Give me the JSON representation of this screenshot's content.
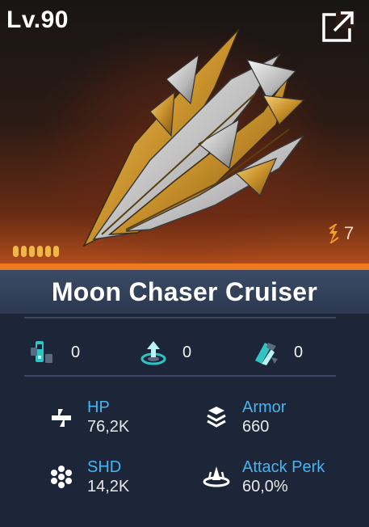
{
  "card": {
    "level": "Lv.90",
    "name": "Moon Chaser Cruiser",
    "energy_value": "7",
    "pips_count": 6,
    "colors": {
      "accent_orange": "#f07a22",
      "stat_label_blue": "#45b4f0",
      "pip_gold": "#f0b64a"
    }
  },
  "slots": [
    {
      "icon": "module-slot-icon",
      "value": "0"
    },
    {
      "icon": "upgrade-slot-icon",
      "value": "0"
    },
    {
      "icon": "drone-slot-icon",
      "value": "0"
    }
  ],
  "stats": [
    {
      "icon": "hp-cross-icon",
      "label": "HP",
      "value": "76,2K"
    },
    {
      "icon": "armor-layers-icon",
      "label": "Armor",
      "value": "660"
    },
    {
      "icon": "shield-hex-icon",
      "label": "SHD",
      "value": "14,2K"
    },
    {
      "icon": "attack-perk-icon",
      "label": "Attack Perk",
      "value": "60,0%"
    }
  ]
}
